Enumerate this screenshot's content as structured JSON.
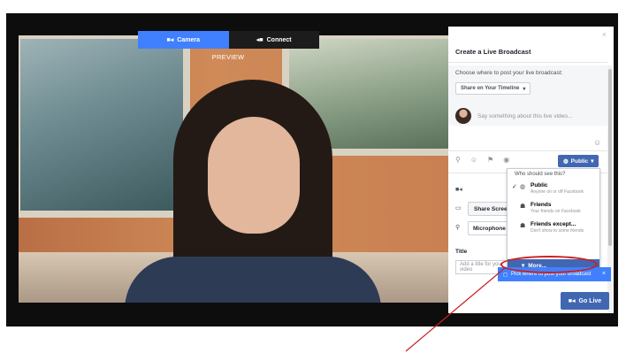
{
  "video": {
    "tabs": [
      {
        "icon": "camera-icon",
        "label": "Camera",
        "active": true
      },
      {
        "icon": "connect-icon",
        "label": "Connect",
        "active": false
      }
    ],
    "preview_label": "PREVIEW"
  },
  "panel": {
    "title": "Create a Live Broadcast",
    "close": "×",
    "choose_label": "Choose where to post your live broadcast:",
    "share_on": "Share on Your Timeline",
    "composer_placeholder": "Say something about this live video...",
    "privacy_button": "Public",
    "share_screen": "Share Screen",
    "microphone": "Microphone",
    "title_label": "Title",
    "title_placeholder": "Add a title for your video"
  },
  "privacy_dropdown": {
    "header": "Who should see this?",
    "options": [
      {
        "name": "Public",
        "sub": "Anyone on or off Facebook",
        "icon": "globe-icon",
        "selected": true
      },
      {
        "name": "Friends",
        "sub": "Your friends on Facebook",
        "icon": "friends-icon",
        "selected": false
      },
      {
        "name": "Friends except...",
        "sub": "Don't show to some friends",
        "icon": "friends-except-icon",
        "selected": false
      }
    ],
    "more": "More..."
  },
  "tooltip": {
    "text": "Pick where to post your broadcast",
    "close": "×"
  },
  "go_live": "Go Live",
  "colors": {
    "accent": "#4267b2",
    "tab_blue": "#4080ff",
    "annotation": "#cc1f1f"
  }
}
